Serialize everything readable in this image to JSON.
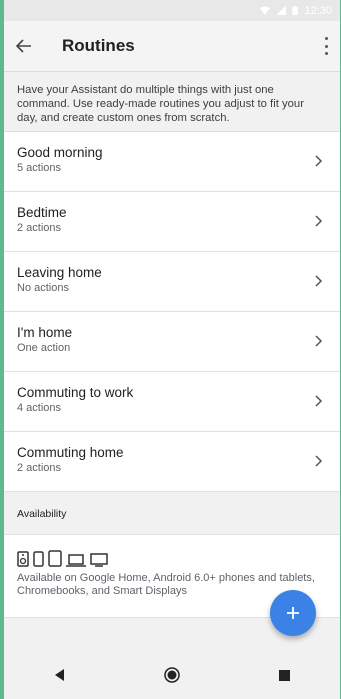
{
  "statusbar": {
    "time": "12:30"
  },
  "appbar": {
    "title": "Routines"
  },
  "description": "Have your Assistant do multiple things with just one command. Use ready-made routines you adjust to fit your day, and create custom ones from scratch.",
  "routines": [
    {
      "name": "Good morning",
      "actions": "5 actions"
    },
    {
      "name": "Bedtime",
      "actions": "2 actions"
    },
    {
      "name": "Leaving home",
      "actions": "No actions"
    },
    {
      "name": "I'm home",
      "actions": "One action"
    },
    {
      "name": "Commuting to work",
      "actions": "4 actions"
    },
    {
      "name": "Commuting home",
      "actions": "2 actions"
    }
  ],
  "availability": {
    "header": "Availability",
    "text": "Available on Google Home, Android 6.0+ phones and tablets, Chromebooks, and Smart Displays"
  },
  "colors": {
    "accent": "#3b82e6",
    "background": "#f1f1f1"
  }
}
